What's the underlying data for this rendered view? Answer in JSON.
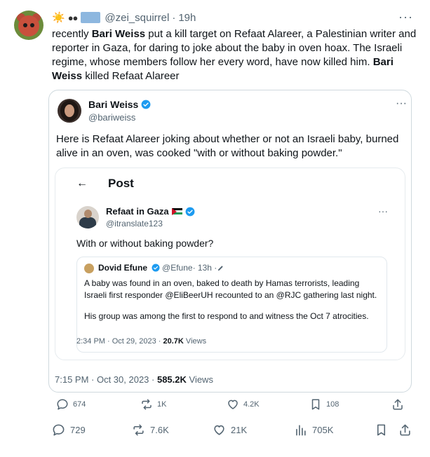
{
  "post": {
    "display_name_emoji": "☀️",
    "handle": "@zei_squirrel",
    "separator": "·",
    "time": "19h",
    "more": "···",
    "text_parts": [
      "recently ",
      "Bari Weiss",
      " put a kill target on Refaat Alareer, a Palestinian writer and reporter in Gaza, for daring to joke about the baby in oven hoax. The Israeli regime, whose members follow her every word, have now killed him. ",
      "Bari Weiss",
      " killed Refaat Alareer"
    ]
  },
  "quote": {
    "name": "Bari Weiss",
    "handle": "@bariweiss",
    "more": "···",
    "text": "Here is Refaat Alareer joking about whether or not an Israeli baby, burned alive in an oven, was cooked \"with or without baking powder.\"",
    "timestamp": "7:15 PM · Oct 30, 2023 · ",
    "views_count": "585.2K",
    "views_label": " Views",
    "actions": {
      "reply": "674",
      "repost": "1K",
      "like": "4.2K",
      "bookmark": "108"
    }
  },
  "screenshot_post": {
    "back": "←",
    "title": "Post",
    "name": "Refaat in Gaza",
    "handle": "@itranslate123",
    "more": "···",
    "text": "With or without baking powder?",
    "nested": {
      "name": "Dovid Efune",
      "handle": "@Efune",
      "time": " · 13h · ",
      "text": "A baby was found in an oven, baked to death by Hamas terrorists, leading Israeli first responder @EliBeerUH recounted to an @RJC gathering last night.",
      "text2": "His group was among the first to respond to and witness the Oct 7 atrocities."
    },
    "timestamp": "2:34 PM · Oct 29, 2023 · ",
    "views_count": "20.7K",
    "views_label": " Views"
  },
  "actions": {
    "reply": "729",
    "repost": "7.6K",
    "like": "21K",
    "views": "705K"
  },
  "colors": {
    "text": "#0f1419",
    "secondary": "#536471",
    "verified": "#1d9bf0",
    "border": "#cfd9de"
  }
}
